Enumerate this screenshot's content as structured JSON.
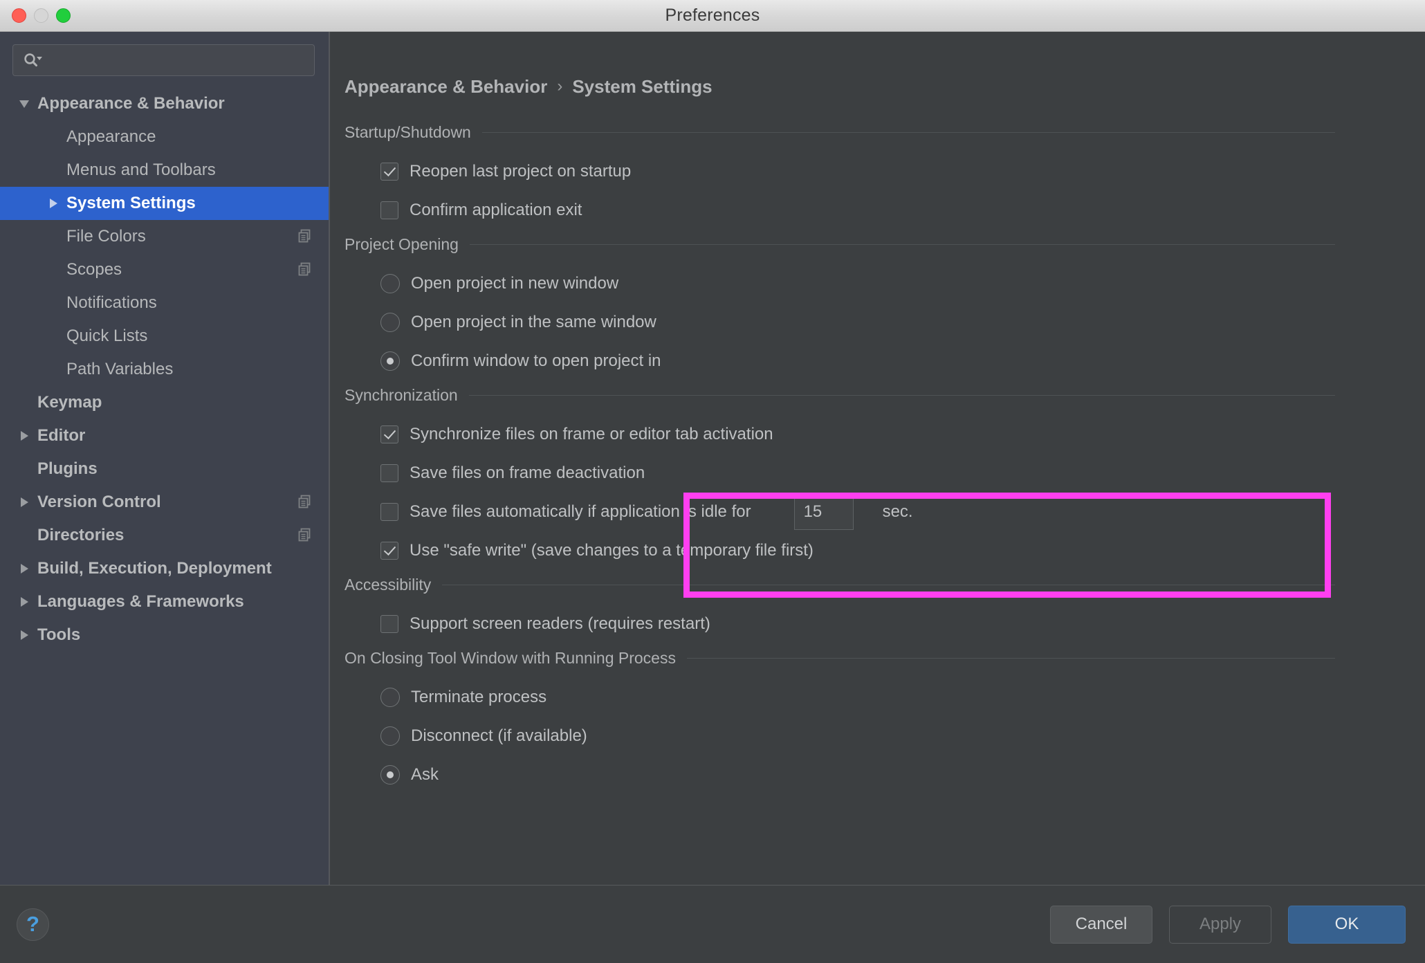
{
  "window": {
    "title": "Preferences",
    "traffic_lights": [
      "close",
      "minimize",
      "zoom"
    ]
  },
  "sidebar": {
    "search": {
      "value": "",
      "placeholder": ""
    },
    "items": [
      {
        "label": "Appearance & Behavior",
        "level": 0,
        "bold": true,
        "twisty": "down",
        "selected": false,
        "badge": false
      },
      {
        "label": "Appearance",
        "level": 1,
        "bold": false,
        "twisty": "none",
        "selected": false,
        "badge": false
      },
      {
        "label": "Menus and Toolbars",
        "level": 1,
        "bold": false,
        "twisty": "none",
        "selected": false,
        "badge": false
      },
      {
        "label": "System Settings",
        "level": 1,
        "bold": true,
        "twisty": "right",
        "selected": true,
        "badge": false
      },
      {
        "label": "File Colors",
        "level": 1,
        "bold": false,
        "twisty": "none",
        "selected": false,
        "badge": true
      },
      {
        "label": "Scopes",
        "level": 1,
        "bold": false,
        "twisty": "none",
        "selected": false,
        "badge": true
      },
      {
        "label": "Notifications",
        "level": 1,
        "bold": false,
        "twisty": "none",
        "selected": false,
        "badge": false
      },
      {
        "label": "Quick Lists",
        "level": 1,
        "bold": false,
        "twisty": "none",
        "selected": false,
        "badge": false
      },
      {
        "label": "Path Variables",
        "level": 1,
        "bold": false,
        "twisty": "none",
        "selected": false,
        "badge": false
      },
      {
        "label": "Keymap",
        "level": 0,
        "bold": true,
        "twisty": "none",
        "selected": false,
        "badge": false
      },
      {
        "label": "Editor",
        "level": 0,
        "bold": true,
        "twisty": "right",
        "selected": false,
        "badge": false
      },
      {
        "label": "Plugins",
        "level": 0,
        "bold": true,
        "twisty": "none",
        "selected": false,
        "badge": false
      },
      {
        "label": "Version Control",
        "level": 0,
        "bold": true,
        "twisty": "right",
        "selected": false,
        "badge": true
      },
      {
        "label": "Directories",
        "level": 0,
        "bold": true,
        "twisty": "none",
        "selected": false,
        "badge": true
      },
      {
        "label": "Build, Execution, Deployment",
        "level": 0,
        "bold": true,
        "twisty": "right",
        "selected": false,
        "badge": false
      },
      {
        "label": "Languages & Frameworks",
        "level": 0,
        "bold": true,
        "twisty": "right",
        "selected": false,
        "badge": false
      },
      {
        "label": "Tools",
        "level": 0,
        "bold": true,
        "twisty": "right",
        "selected": false,
        "badge": false
      }
    ]
  },
  "breadcrumb": {
    "parent": "Appearance & Behavior",
    "separator": "›",
    "current": "System Settings"
  },
  "groups": [
    {
      "title": "Startup/Shutdown",
      "options": [
        {
          "type": "checkbox",
          "label": "Reopen last project on startup",
          "checked": true
        },
        {
          "type": "checkbox",
          "label": "Confirm application exit",
          "checked": false
        }
      ]
    },
    {
      "title": "Project Opening",
      "options": [
        {
          "type": "radio",
          "label": "Open project in new window",
          "checked": false
        },
        {
          "type": "radio",
          "label": "Open project in the same window",
          "checked": false
        },
        {
          "type": "radio",
          "label": "Confirm window to open project in",
          "checked": true
        }
      ]
    },
    {
      "title": "Synchronization",
      "options": [
        {
          "type": "checkbox",
          "label": "Synchronize files on frame or editor tab activation",
          "checked": true
        },
        {
          "type": "checkbox",
          "label": "Save files on frame deactivation",
          "checked": false
        },
        {
          "type": "checkbox",
          "label": "Save files automatically if application is idle for",
          "checked": false,
          "spinner": {
            "value": "15"
          },
          "suffix": "sec."
        },
        {
          "type": "checkbox",
          "label": "Use \"safe write\" (save changes to a temporary file first)",
          "checked": true
        }
      ]
    },
    {
      "title": "Accessibility",
      "options": [
        {
          "type": "checkbox",
          "label": "Support screen readers (requires restart)",
          "checked": false
        }
      ]
    },
    {
      "title": "On Closing Tool Window with Running Process",
      "options": [
        {
          "type": "radio",
          "label": "Terminate process",
          "checked": false
        },
        {
          "type": "radio",
          "label": "Disconnect (if available)",
          "checked": false
        },
        {
          "type": "radio",
          "label": "Ask",
          "checked": true
        }
      ]
    }
  ],
  "highlight": {
    "color": "#ff3ff0",
    "encloses": [
      "Save files on frame deactivation",
      "Save files automatically if application is idle for"
    ]
  },
  "footer": {
    "help_label": "?",
    "cancel_label": "Cancel",
    "apply_label": "Apply",
    "ok_label": "OK"
  },
  "colors": {
    "selection": "#2d62cd",
    "sidebar_bg": "#3e424d",
    "panel_bg": "#3c3f41",
    "ok_button": "#37618f",
    "highlight": "#ff3ff0",
    "help_icon": "#4a9fe0"
  }
}
